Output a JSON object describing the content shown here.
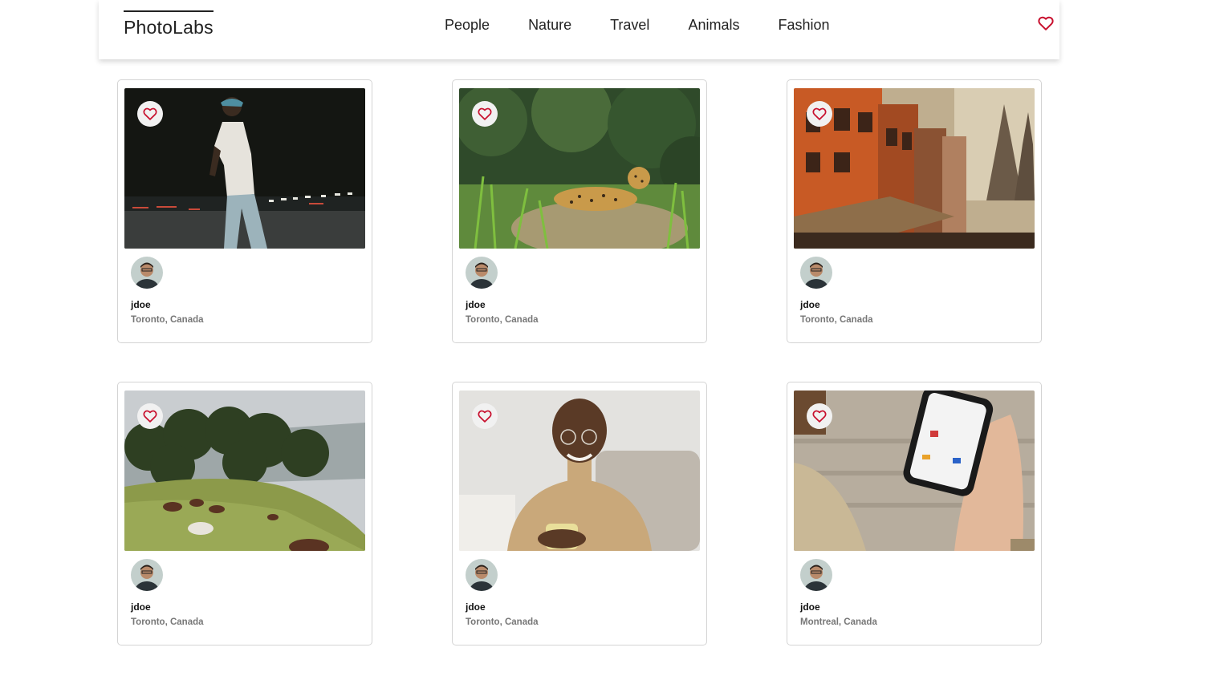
{
  "app": {
    "logo": "PhotoLabs"
  },
  "nav": {
    "items": [
      "People",
      "Nature",
      "Travel",
      "Animals",
      "Fashion"
    ]
  },
  "header": {
    "favorite_icon": "heart-outline-icon",
    "accent_color": "#c8102e"
  },
  "photos": [
    {
      "username": "jdoe",
      "location": "Toronto, Canada",
      "scene": "person-night-street"
    },
    {
      "username": "jdoe",
      "location": "Toronto, Canada",
      "scene": "jaguar-in-grass"
    },
    {
      "username": "jdoe",
      "location": "Toronto, Canada",
      "scene": "orange-buildings-temple"
    },
    {
      "username": "jdoe",
      "location": "Toronto, Canada",
      "scene": "horses-grazing-hillside"
    },
    {
      "username": "jdoe",
      "location": "Toronto, Canada",
      "scene": "smiling-man-with-mug"
    },
    {
      "username": "jdoe",
      "location": "Montreal, Canada",
      "scene": "hand-holding-phone"
    }
  ]
}
